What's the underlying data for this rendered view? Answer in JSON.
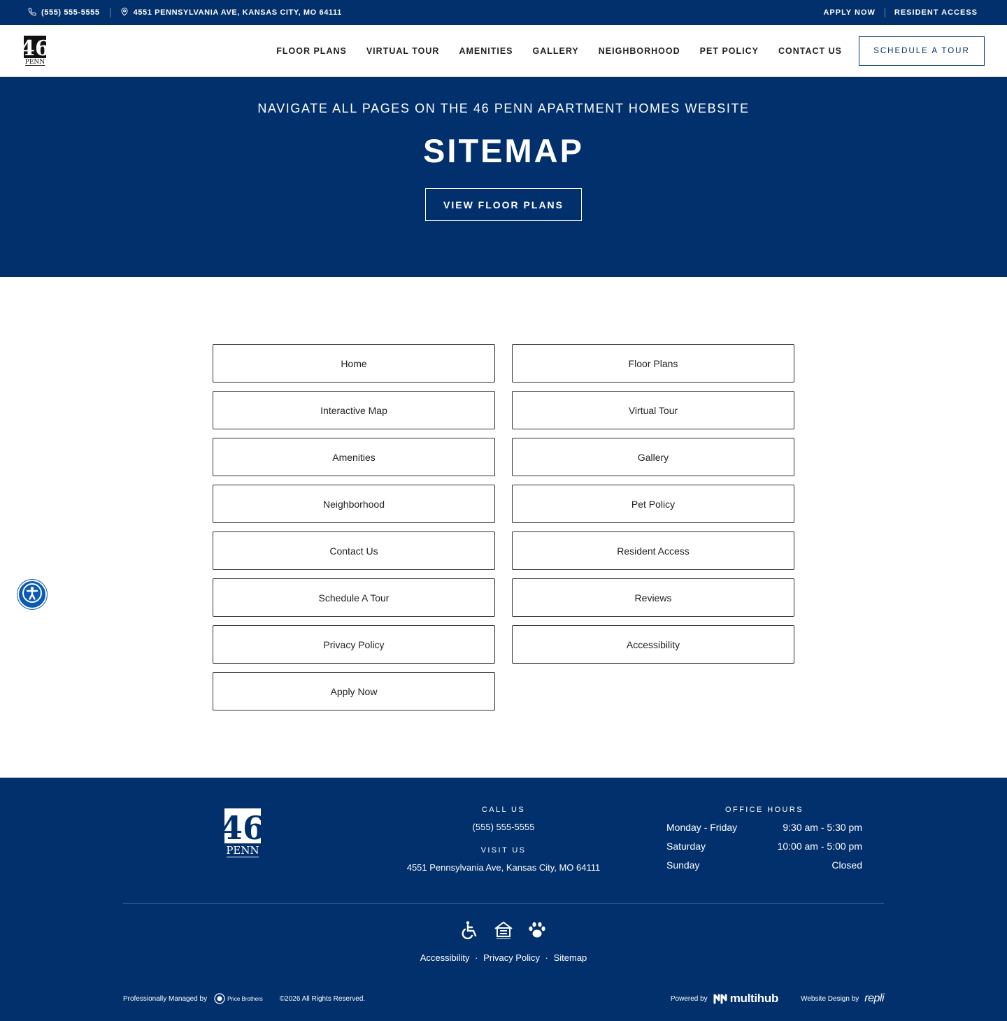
{
  "topbar": {
    "phone": "(555) 555-5555",
    "address": "4551 PENNSYLVANIA AVE, KANSAS CITY, MO 64111",
    "apply_now": "APPLY NOW",
    "resident_access": "RESIDENT ACCESS"
  },
  "header": {
    "logo_number": "46",
    "logo_word": "PENN",
    "nav": [
      {
        "label": "FLOOR PLANS"
      },
      {
        "label": "VIRTUAL TOUR"
      },
      {
        "label": "AMENITIES"
      },
      {
        "label": "GALLERY"
      },
      {
        "label": "NEIGHBORHOOD"
      },
      {
        "label": "PET POLICY"
      },
      {
        "label": "CONTACT US"
      }
    ],
    "schedule_tour": "SCHEDULE A TOUR"
  },
  "hero": {
    "eyebrow": "NAVIGATE ALL PAGES ON THE 46 PENN APARTMENT HOMES WEBSITE",
    "title": "SITEMAP",
    "cta": "VIEW FLOOR PLANS"
  },
  "sitemap": {
    "links": [
      "Home",
      "Floor Plans",
      "Interactive Map",
      "Virtual Tour",
      "Amenities",
      "Gallery",
      "Neighborhood",
      "Pet Policy",
      "Contact Us",
      "Resident Access",
      "Schedule A Tour",
      "Reviews",
      "Privacy Policy",
      "Accessibility",
      "Apply Now"
    ]
  },
  "footer": {
    "call_heading": "CALL US",
    "phone": "(555) 555-5555",
    "visit_heading": "VISIT US",
    "address": "4551 Pennsylvania Ave, Kansas City, MO 64111",
    "hours_heading": "OFFICE HOURS",
    "hours": [
      {
        "day": "Monday - Friday",
        "time": "9:30 am - 5:30 pm"
      },
      {
        "day": "Saturday",
        "time": "10:00 am - 5:00 pm"
      },
      {
        "day": "Sunday",
        "time": "Closed"
      }
    ],
    "links": {
      "accessibility": "Accessibility",
      "privacy": "Privacy Policy",
      "sitemap": "Sitemap",
      "separator": "·"
    },
    "managed_by": "Professionally Managed by",
    "manager_name": "Price Brothers",
    "copyright": "©2026 All Rights Reserved.",
    "powered_by": "Powered by",
    "powered_brand": "multihub",
    "design_by": "Website Design by",
    "design_brand": "repli"
  },
  "colors": {
    "navy": "#01306c",
    "accessibility_blue": "#0a5ab8"
  },
  "icons": {
    "phone": "phone-icon",
    "location": "map-pin-icon",
    "accessibility_fab": "accessibility-person-icon",
    "wheelchair": "wheelchair-icon",
    "equal_housing": "equal-housing-icon",
    "pet": "paw-icon"
  }
}
